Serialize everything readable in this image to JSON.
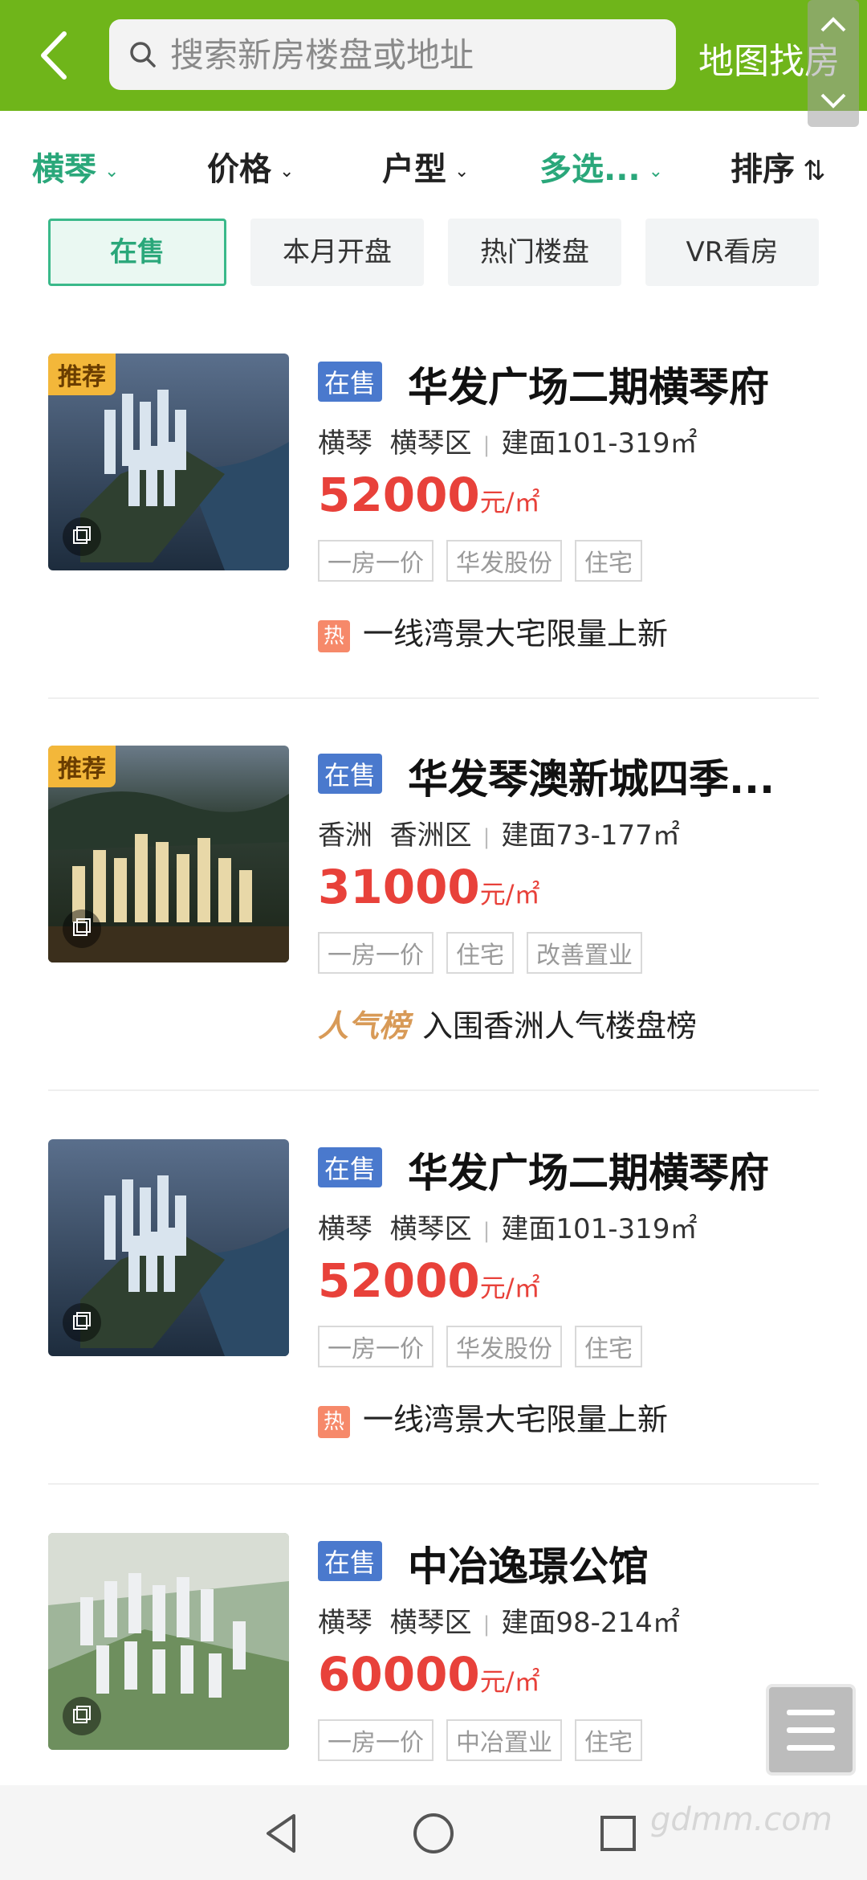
{
  "header": {
    "search_placeholder": "搜索新房楼盘或地址",
    "map_button": "地图找房"
  },
  "filters": [
    {
      "label": "横琴",
      "active": true
    },
    {
      "label": "价格",
      "active": false
    },
    {
      "label": "户型",
      "active": false
    },
    {
      "label": "多选...",
      "active": true
    },
    {
      "label": "排序",
      "active": false
    }
  ],
  "chips": [
    "在售",
    "本月开盘",
    "热门楼盘",
    "VR看房"
  ],
  "listings": [
    {
      "badge": "推荐",
      "status": "在售",
      "title": "华发广场二期横琴府",
      "area1": "横琴",
      "area2": "横琴区",
      "size": "建面101-319㎡",
      "price": "52000",
      "unit": "元/㎡",
      "tags": [
        "一房一价",
        "华发股份",
        "住宅"
      ],
      "promo_icon": "热",
      "promo": "一线湾景大宅限量上新"
    },
    {
      "badge": "推荐",
      "status": "在售",
      "title": "华发琴澳新城四季...",
      "area1": "香洲",
      "area2": "香洲区",
      "size": "建面73-177㎡",
      "price": "31000",
      "unit": "元/㎡",
      "tags": [
        "一房一价",
        "住宅",
        "改善置业"
      ],
      "promo_icon": "人气榜",
      "promo": "入围香洲人气楼盘榜"
    },
    {
      "status": "在售",
      "title": "华发广场二期横琴府",
      "area1": "横琴",
      "area2": "横琴区",
      "size": "建面101-319㎡",
      "price": "52000",
      "unit": "元/㎡",
      "tags": [
        "一房一价",
        "华发股份",
        "住宅"
      ],
      "promo_icon": "热",
      "promo": "一线湾景大宅限量上新"
    },
    {
      "status": "在售",
      "title": "中冶逸璟公馆",
      "area1": "横琴",
      "area2": "横琴区",
      "size": "建面98-214㎡",
      "price": "60000",
      "unit": "元/㎡",
      "tags": [
        "一房一价",
        "中冶置业",
        "住宅"
      ]
    }
  ],
  "watermark": "gdmm.com",
  "colors": {
    "header": "#6fb51a",
    "accent": "#2aa77a",
    "price": "#e8413a",
    "status": "#4a79cd"
  }
}
